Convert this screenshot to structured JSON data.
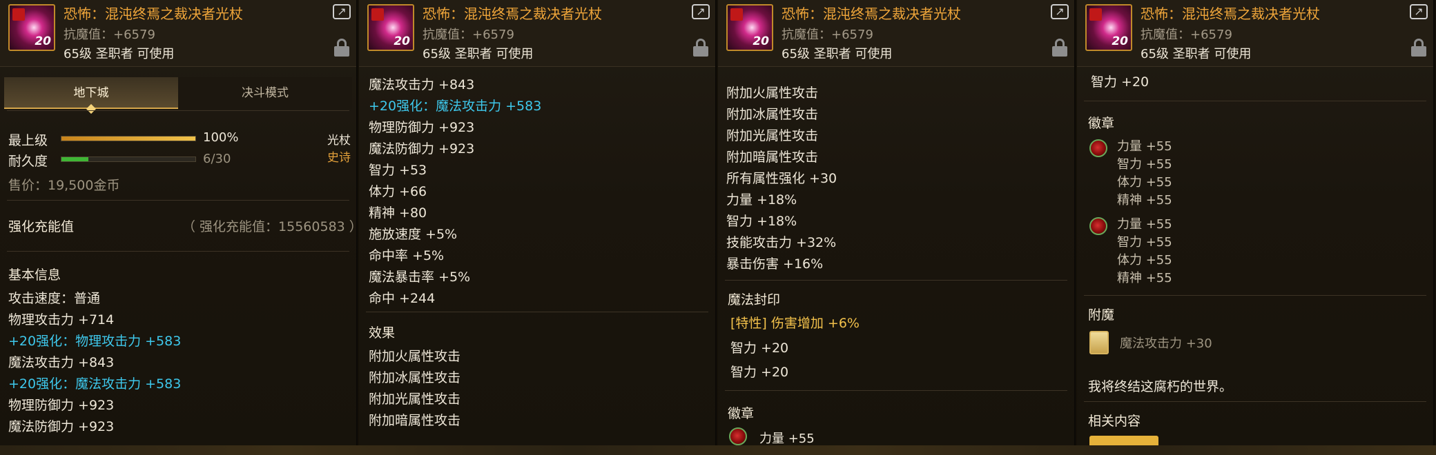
{
  "item": {
    "name": "恐怖：混沌终焉之裁决者光杖",
    "anti_magic": "抗魔值：+6579",
    "requirement": "65级 圣职者 可使用",
    "level_badge": "20",
    "icon": "staff-item-icon"
  },
  "panel1": {
    "tabs": [
      "地下城",
      "决斗模式"
    ],
    "grade_label": "最上级",
    "grade_percent": 1.0,
    "grade_text": "100%",
    "durability_label": "耐久度",
    "durability_value": 6,
    "durability_max": 30,
    "durability_text": "6/30",
    "weapon_type": "光杖",
    "rarity": "史诗",
    "price": "售价：19,500金币",
    "reinforce_label": "强化充能值",
    "reinforce_value": "（ 强化充能值：15560583 ）",
    "basic_info_title": "基本信息",
    "lines": [
      {
        "text": "攻击速度：普通",
        "style": "w"
      },
      {
        "text": "物理攻击力 +714",
        "style": "w"
      },
      {
        "text": "+20强化：物理攻击力 +583",
        "style": "c"
      },
      {
        "text": "魔法攻击力 +843",
        "style": "w"
      },
      {
        "text": "+20强化：魔法攻击力 +583",
        "style": "c"
      },
      {
        "text": "物理防御力 +923",
        "style": "w"
      },
      {
        "text": "魔法防御力 +923",
        "style": "w"
      }
    ]
  },
  "panel2": {
    "lines": [
      {
        "text": "魔法攻击力 +843",
        "style": "w"
      },
      {
        "text": "+20强化：魔法攻击力 +583",
        "style": "c"
      },
      {
        "text": "物理防御力 +923",
        "style": "w"
      },
      {
        "text": "魔法防御力 +923",
        "style": "w"
      },
      {
        "text": "智力 +53",
        "style": "w"
      },
      {
        "text": "体力 +66",
        "style": "w"
      },
      {
        "text": "精神 +80",
        "style": "w"
      },
      {
        "text": "施放速度 +5%",
        "style": "w"
      },
      {
        "text": "命中率 +5%",
        "style": "w"
      },
      {
        "text": "魔法暴击率 +5%",
        "style": "w"
      },
      {
        "text": "命中 +244",
        "style": "w"
      }
    ],
    "effects_title": "效果",
    "effects": [
      "附加火属性攻击",
      "附加冰属性攻击",
      "附加光属性攻击",
      "附加暗属性攻击"
    ]
  },
  "panel3": {
    "effects": [
      "附加火属性攻击",
      "附加冰属性攻击",
      "附加光属性攻击",
      "附加暗属性攻击",
      "所有属性强化 +30",
      "力量 +18%",
      "智力 +18%",
      "技能攻击力 +32%",
      "暴击伤害 +16%"
    ],
    "seal_title": "魔法封印",
    "seal_special": "[特性] 伤害增加 +6%",
    "seal_lines": [
      "智力 +20",
      "智力 +20"
    ],
    "emblem_title": "徽章",
    "emblem_first": "力量 +55"
  },
  "panel4": {
    "top_line": "智力 +20",
    "emblem_title": "徽章",
    "emblems": [
      [
        "力量 +55",
        "智力 +55",
        "体力 +55",
        "精神 +55"
      ],
      [
        "力量 +55",
        "智力 +55",
        "体力 +55",
        "精神 +55"
      ]
    ],
    "enchant_title": "附魔",
    "enchant_value": "魔法攻击力 +30",
    "flavor": "我将终结这腐朽的世界。",
    "related_title": "相关内容"
  },
  "colors": {
    "name": "#f0a63a",
    "reinforce": "#3ec8ec",
    "special": "#f2c14b",
    "grade_bar": "#e7b13b",
    "durability_bar": "#3fb635"
  }
}
